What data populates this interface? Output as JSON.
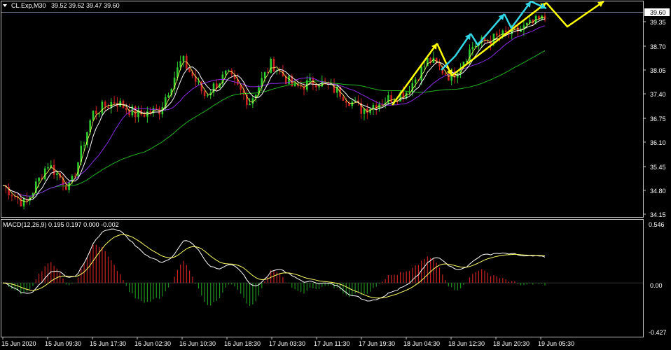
{
  "header": {
    "symbol": "CL.Exp,M30",
    "ohlc": "39.52 39.62 39.47 39.60",
    "dropdown_icon": "triangle-down-icon"
  },
  "price_axis": {
    "current_price": "39.60",
    "labels": [
      "39.35",
      "38.70",
      "38.05",
      "37.40",
      "36.75",
      "36.10",
      "35.45",
      "34.80",
      "34.15"
    ]
  },
  "macd": {
    "label": "MACD(12,26,9) 0.195 0.197 0.000 -0.002",
    "axis_labels": [
      "0.546",
      "0.00",
      "-0.427"
    ]
  },
  "time_axis": {
    "labels": [
      "15 Jun 2020",
      "15 Jun 09:30",
      "15 Jun 17:30",
      "16 Jun 02:30",
      "16 Jun 10:30",
      "16 Jun 18:30",
      "17 Jun 03:30",
      "17 Jun 11:30",
      "17 Jun 19:30",
      "18 Jun 04:30",
      "18 Jun 12:30",
      "18 Jun 20:30",
      "19 Jun 05:30"
    ]
  },
  "colors": {
    "background": "#000000",
    "bull_candle": "#2ecc2e",
    "bear_candle": "#cc2222",
    "ma_green": "#22b322",
    "ma_purple": "#8a2be2",
    "ma_white": "#ffffff",
    "ma_yellow": "#ffff66",
    "arrow_yellow": "#ffff00",
    "arrow_cyan": "#33d6e6",
    "macd_pos_hist": "#cc2222",
    "macd_neg_hist": "#1f8f1f",
    "grid_axis": "#c0c0c0"
  },
  "chart_data": {
    "type": "candlestick",
    "symbol": "CL.Exp",
    "timeframe": "M30",
    "last_bar": {
      "open": 39.52,
      "high": 39.62,
      "low": 39.47,
      "close": 39.6
    },
    "ylim": [
      34.15,
      39.9
    ],
    "price_path": [
      [
        "15 Jun 2020",
        35.0
      ],
      [
        "15 Jun 2020",
        34.45
      ],
      [
        "15 Jun 09:30",
        35.6
      ],
      [
        "15 Jun 09:30",
        34.9
      ],
      [
        "15 Jun 17:30",
        37.0
      ],
      [
        "15 Jun 17:30",
        37.35
      ],
      [
        "16 Jun 02:30",
        36.95
      ],
      [
        "16 Jun 02:30",
        37.1
      ],
      [
        "16 Jun 10:30",
        38.5
      ],
      [
        "16 Jun 10:30",
        37.5
      ],
      [
        "16 Jun 18:30",
        38.1
      ],
      [
        "16 Jun 18:30",
        37.3
      ],
      [
        "17 Jun 03:30",
        38.4
      ],
      [
        "17 Jun 03:30",
        37.7
      ],
      [
        "17 Jun 11:30",
        37.9
      ],
      [
        "17 Jun 11:30",
        37.6
      ],
      [
        "17 Jun 19:30",
        37.1
      ],
      [
        "18 Jun 04:30",
        37.6
      ],
      [
        "18 Jun 04:30",
        38.5
      ],
      [
        "18 Jun 12:30",
        38.0
      ],
      [
        "18 Jun 12:30",
        38.9
      ],
      [
        "18 Jun 20:30",
        39.1
      ],
      [
        "18 Jun 20:30",
        39.3
      ],
      [
        "19 Jun 05:30",
        39.6
      ]
    ],
    "macd_ylim": [
      -0.427,
      0.546
    ]
  }
}
